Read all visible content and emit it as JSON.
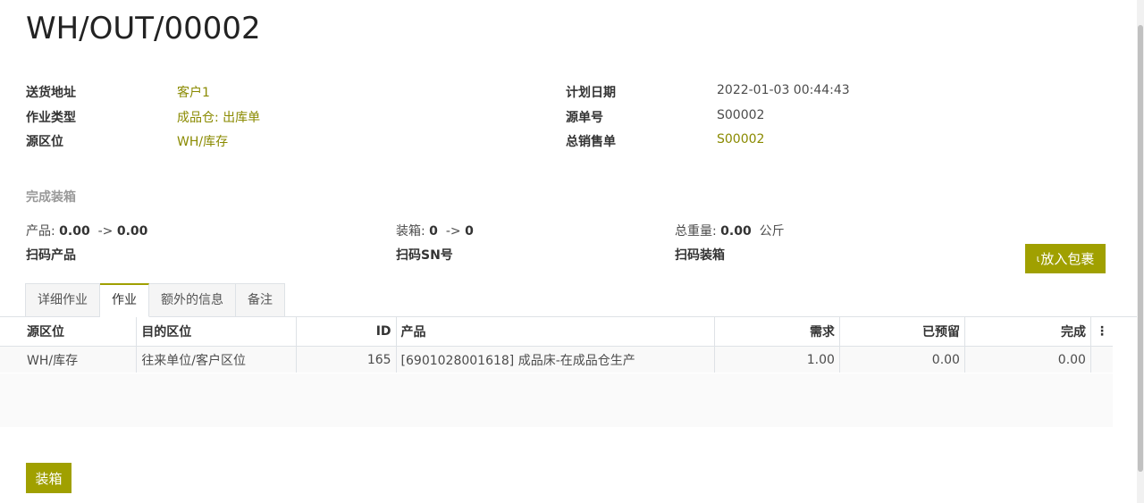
{
  "header": {
    "title": "WH/OUT/00002"
  },
  "fields_left": [
    {
      "label": "送货地址",
      "value": "客户1"
    },
    {
      "label": "作业类型",
      "value": "成品仓: 出库单"
    },
    {
      "label": "源区位",
      "value": "WH/库存"
    }
  ],
  "fields_right": [
    {
      "label": "计划日期",
      "value": "2022-01-03 00:44:43"
    },
    {
      "label": "源单号",
      "value": "S00002"
    },
    {
      "label": "总销售单",
      "value": "S00002"
    }
  ],
  "packing": {
    "section_title": "完成装箱",
    "product_label": "产品:",
    "product_value": "0.00",
    "product_arrow": "->",
    "product_done": "0.00",
    "box_label": "装箱:",
    "box_value": "0",
    "box_arrow": "->",
    "box_done": "0",
    "weight_label": "总重量:",
    "weight_value": "0.00",
    "weight_unit": "公斤",
    "scan_product": "扫码产品",
    "scan_sn": "扫码SN号",
    "scan_box": "扫码装箱",
    "put_in_pack_label": "放入包裹"
  },
  "tabs": [
    "详细作业",
    "作业",
    "额外的信息",
    "备注"
  ],
  "table": {
    "headers": [
      "源区位",
      "目的区位",
      "ID",
      "产品",
      "需求",
      "已预留",
      "完成"
    ],
    "rows": [
      [
        "WH/库存",
        "往来单位/客户区位",
        "165",
        "[6901028001618] 成品床-在成品仓生产",
        "1.00",
        "0.00",
        "0.00"
      ]
    ]
  },
  "footer": {
    "pack_button": "装箱"
  },
  "colors": {
    "accent": "#a0a000",
    "link": "#8a8a00"
  }
}
